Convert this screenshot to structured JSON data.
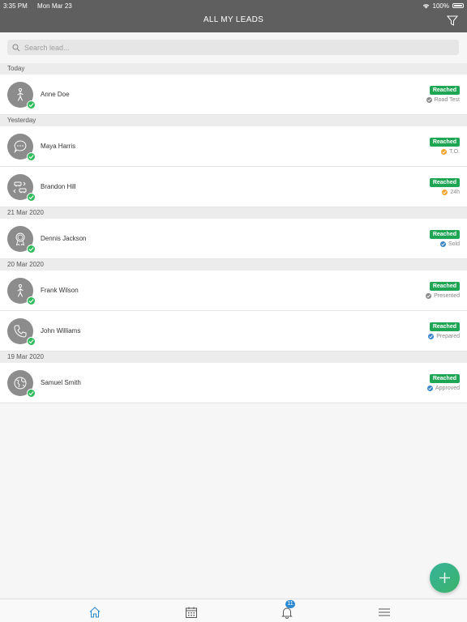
{
  "status_bar": {
    "time": "3:35 PM",
    "date": "Mon Mar 23",
    "battery": "100%"
  },
  "header": {
    "title": "ALL MY LEADS"
  },
  "search": {
    "placeholder": "Search lead..."
  },
  "sections": [
    {
      "label": "Today",
      "leads": [
        {
          "name": "Anne Doe",
          "badge": "Reached",
          "status": "Road Test",
          "status_color": "#8a8a8a",
          "icon": "person-walking-icon"
        }
      ]
    },
    {
      "label": "Yesterday",
      "leads": [
        {
          "name": "Maya Harris",
          "badge": "Reached",
          "status": "T.O.",
          "status_color": "#f0a42c",
          "icon": "chat-bubble-icon"
        },
        {
          "name": "Brandon Hill",
          "badge": "Reached",
          "status": "24h",
          "status_color": "#f0a42c",
          "icon": "car-exchange-icon"
        }
      ]
    },
    {
      "label": "21 Mar 2020",
      "leads": [
        {
          "name": "Dennis Jackson",
          "badge": "Reached",
          "status": "Sold",
          "status_color": "#3a86c8",
          "icon": "award-ribbon-icon"
        }
      ]
    },
    {
      "label": "20 Mar 2020",
      "leads": [
        {
          "name": "Frank Wilson",
          "badge": "Reached",
          "status": "Presented",
          "status_color": "#8a8a8a",
          "icon": "person-walking-icon"
        },
        {
          "name": "John Williams",
          "badge": "Reached",
          "status": "Prepared",
          "status_color": "#3a86c8",
          "icon": "phone-icon"
        }
      ]
    },
    {
      "label": "19 Mar 2020",
      "leads": [
        {
          "name": "Samuel Smith",
          "badge": "Reached",
          "status": "Approved",
          "status_color": "#3a86c8",
          "icon": "globe-icon"
        }
      ]
    }
  ],
  "tabbar": {
    "notifications_count": "11"
  },
  "colors": {
    "header": "#5f5f5f",
    "reached_badge": "#1fa655",
    "check": "#2fbb59",
    "accent": "#2e8ad0"
  }
}
